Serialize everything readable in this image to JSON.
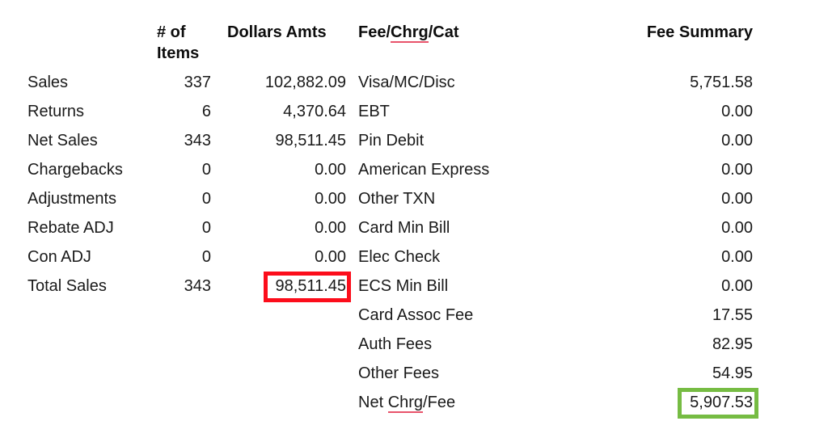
{
  "headers": {
    "items": "# of Items",
    "dollars": "Dollars Amts",
    "fee_category_prefix": "Fee/",
    "fee_category_misspelled": "Chrg",
    "fee_category_suffix": "/Cat",
    "fee_category_full": "Fee/Chrg/Cat",
    "fee_summary": "Fee Summary"
  },
  "sales_rows": [
    {
      "label": "Sales",
      "items": "337",
      "dollars": "102,882.09"
    },
    {
      "label": "Returns",
      "items": "6",
      "dollars": "4,370.64"
    },
    {
      "label": "Net Sales",
      "items": "343",
      "dollars": "98,511.45"
    },
    {
      "label": "Chargebacks",
      "items": "0",
      "dollars": "0.00"
    },
    {
      "label": "Adjustments",
      "items": "0",
      "dollars": "0.00"
    },
    {
      "label": "Rebate ADJ",
      "items": "0",
      "dollars": "0.00"
    },
    {
      "label": "Con ADJ",
      "items": "0",
      "dollars": "0.00"
    },
    {
      "label": "Total Sales",
      "items": "343",
      "dollars": "98,511.45"
    }
  ],
  "fee_rows": [
    {
      "label": "Visa/MC/Disc",
      "amount": "5,751.58"
    },
    {
      "label": "EBT",
      "amount": "0.00"
    },
    {
      "label": "Pin Debit",
      "amount": "0.00"
    },
    {
      "label": "American Express",
      "amount": "0.00"
    },
    {
      "label": "Other TXN",
      "amount": "0.00"
    },
    {
      "label": "Card Min Bill",
      "amount": "0.00"
    },
    {
      "label": "Elec Check",
      "amount": "0.00"
    },
    {
      "label": "ECS Min Bill",
      "amount": "0.00"
    },
    {
      "label": "Card Assoc Fee",
      "amount": "17.55"
    },
    {
      "label": "Auth Fees",
      "amount": "82.95"
    },
    {
      "label": "Other Fees",
      "amount": "54.95"
    },
    {
      "label": "Net Chrg/Fee",
      "label_prefix": "Net ",
      "label_misspelled": "Chrg",
      "label_suffix": "/Fee",
      "amount": "5,907.53"
    }
  ],
  "highlights": {
    "total_sales_dollars": {
      "value": "98,511.45",
      "color": "#fc0d1b"
    },
    "net_charge_fee_amount": {
      "value": "5,907.53",
      "color": "#76bc43"
    }
  }
}
